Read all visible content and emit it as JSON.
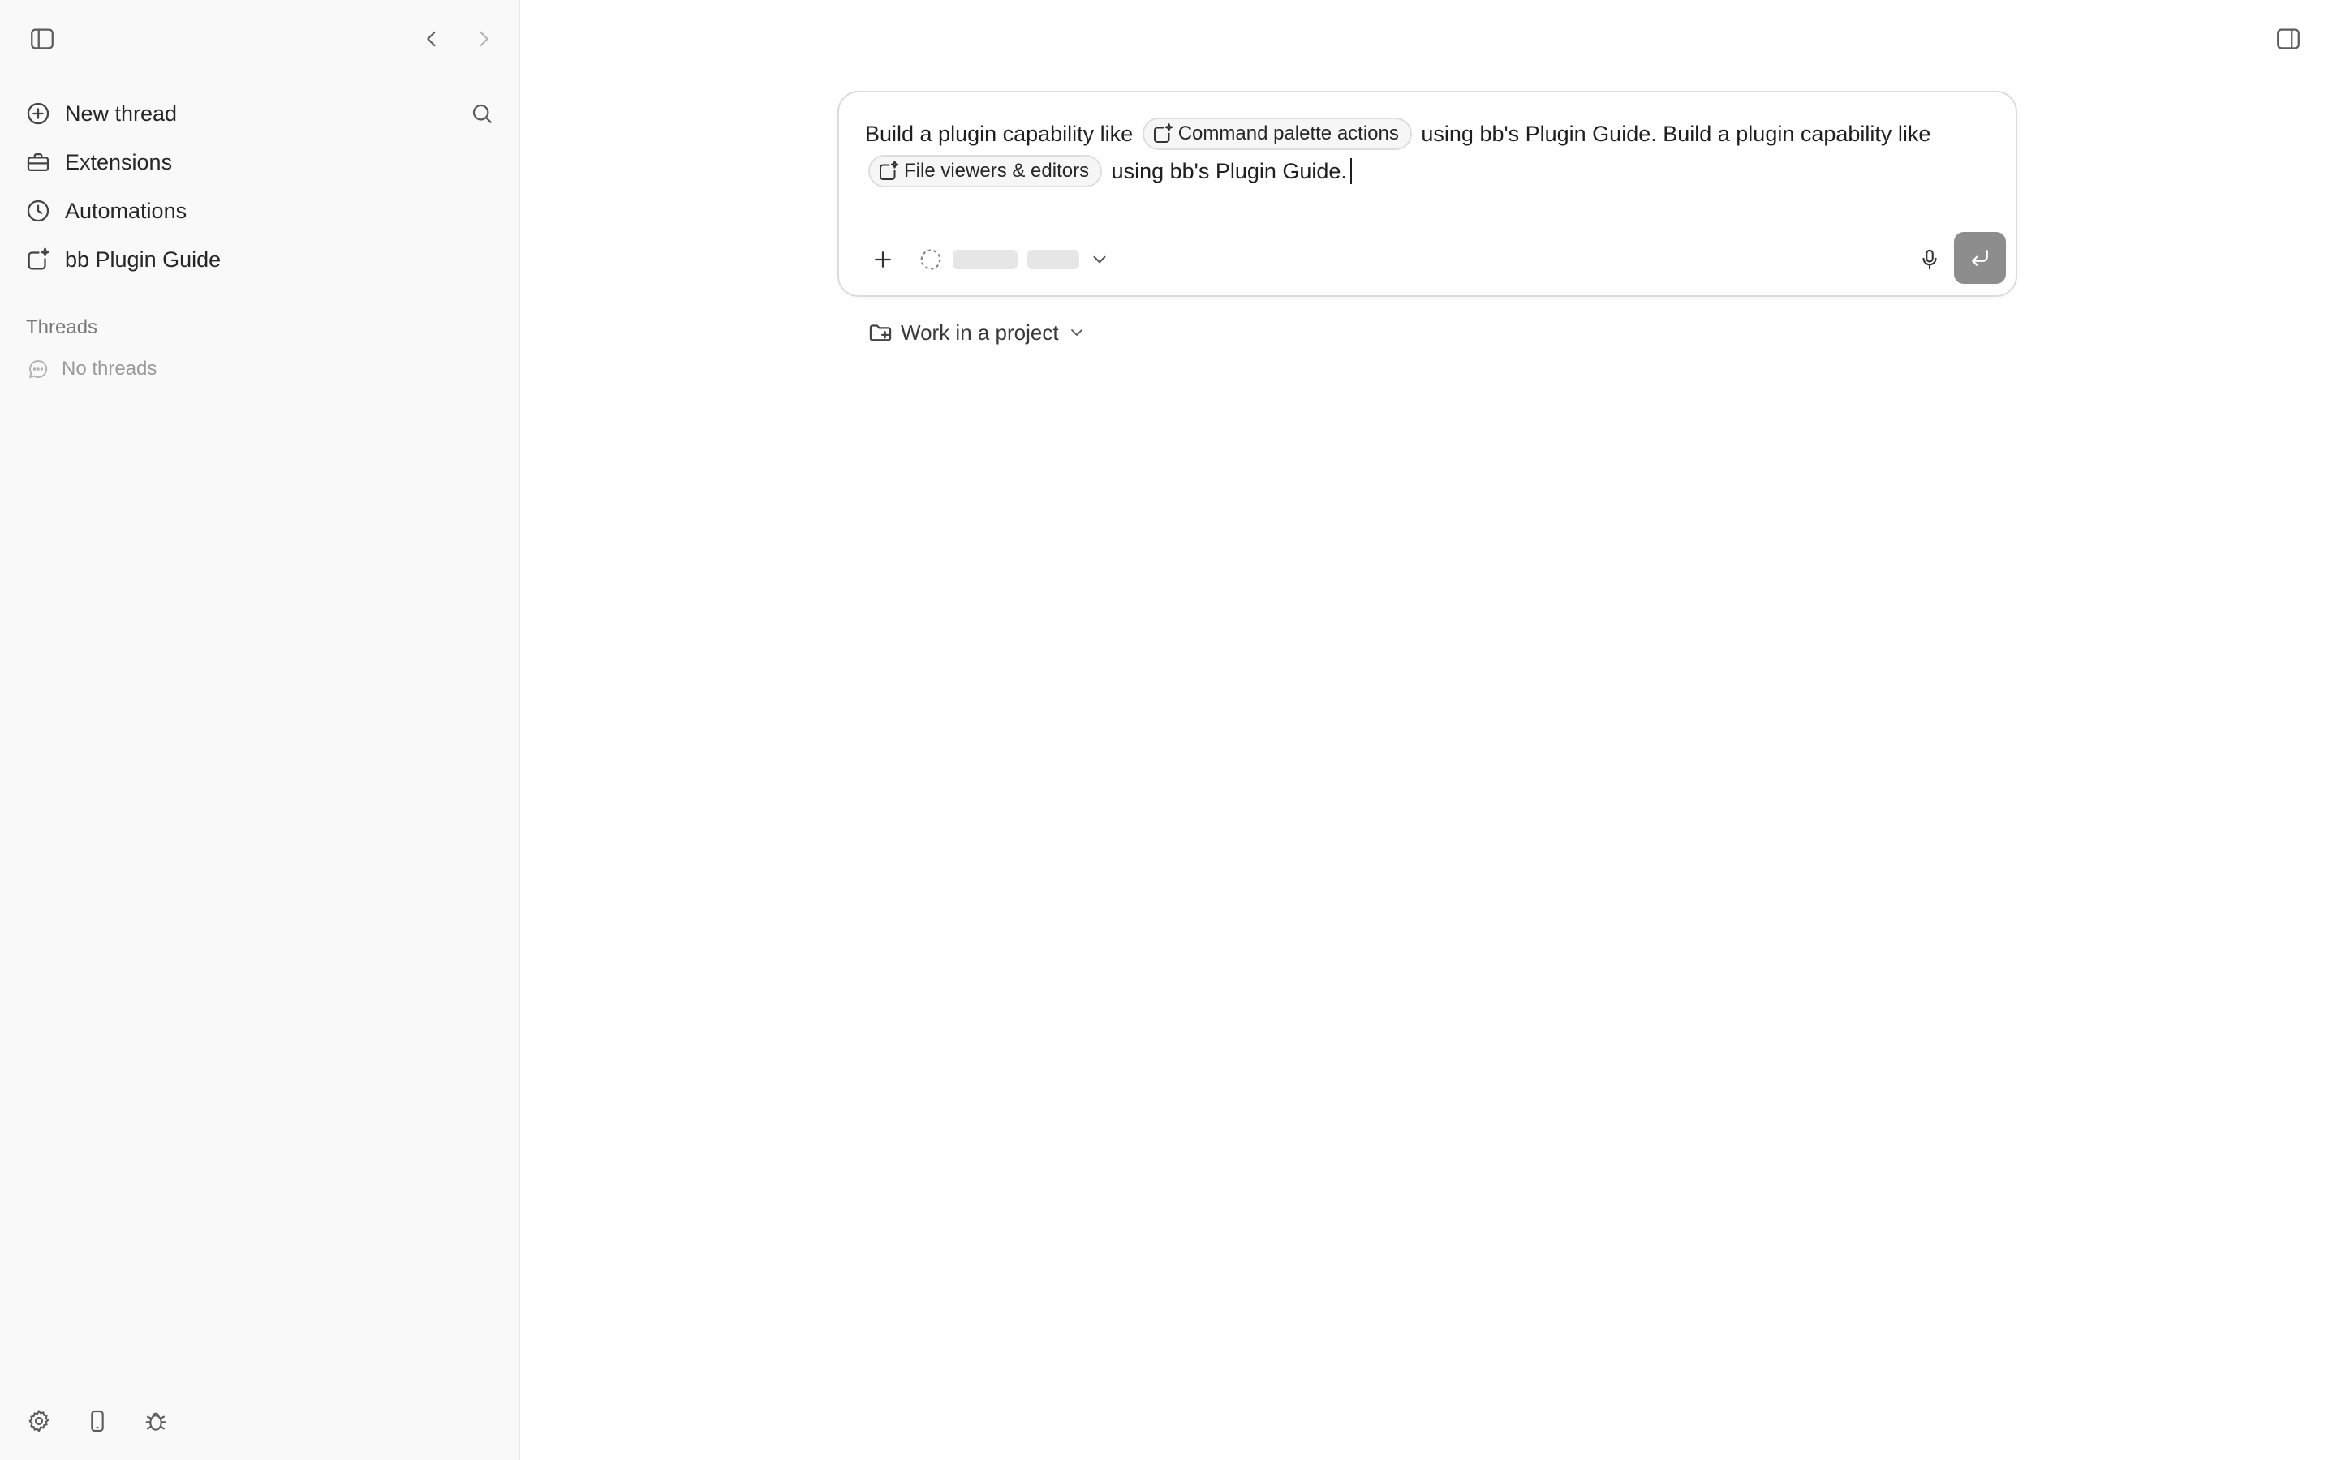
{
  "sidebar": {
    "nav": [
      {
        "label": "New thread",
        "icon": "plus-circle-icon"
      },
      {
        "label": "Extensions",
        "icon": "toolbox-icon"
      },
      {
        "label": "Automations",
        "icon": "clock-icon"
      },
      {
        "label": "bb Plugin Guide",
        "icon": "plugin-sparkle-icon"
      }
    ],
    "threads_heading": "Threads",
    "threads_empty": "No threads"
  },
  "composer": {
    "segments": {
      "text1": "Build a plugin capability like",
      "chip1": "Command palette actions",
      "text2": "using bb's Plugin Guide. Build a plugin capability like",
      "chip2": "File viewers & editors",
      "text3": "using bb's Plugin Guide."
    }
  },
  "project_selector": {
    "label": "Work in a project"
  },
  "colors": {
    "sidebar_bg": "#f9f9f9",
    "send_button_disabled": "#8d8d8d",
    "chip_bg": "#f6f6f6"
  }
}
